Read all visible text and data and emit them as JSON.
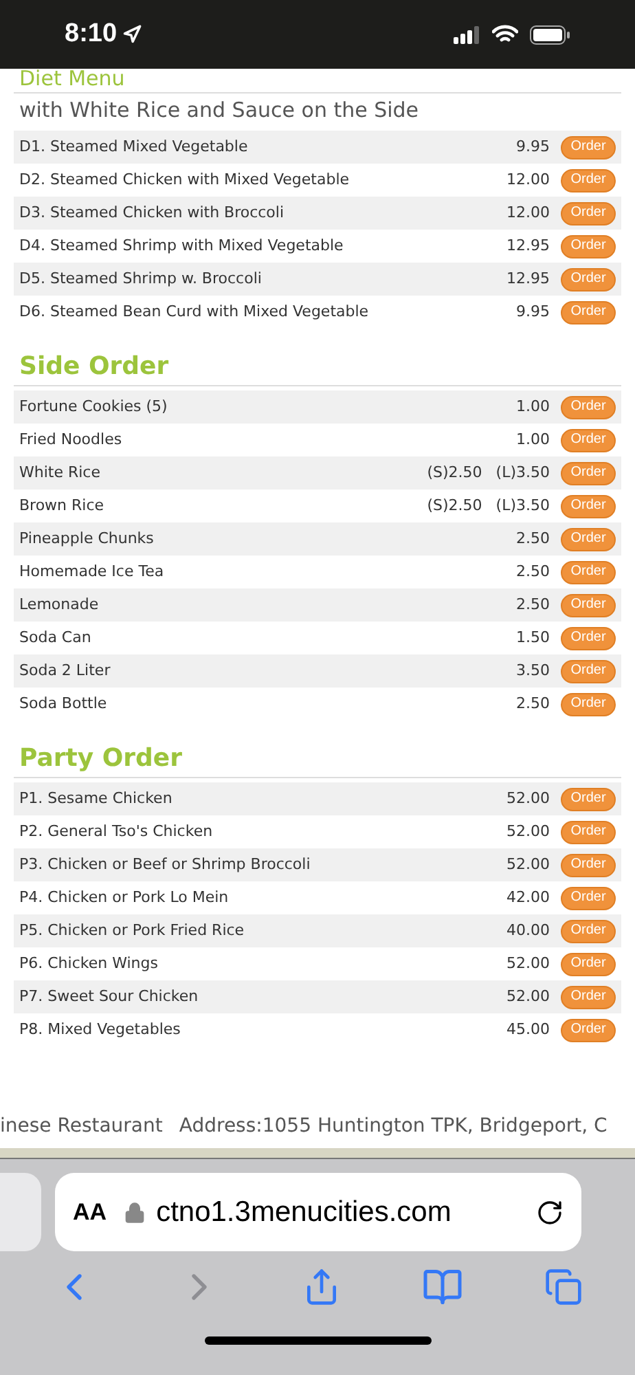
{
  "status_bar": {
    "time": "8:10"
  },
  "sections": [
    {
      "title": "Diet Menu",
      "subtitle": "with White Rice and Sauce on the Side",
      "items": [
        {
          "name": "D1. Steamed Mixed Vegetable",
          "prices": [
            "9.95"
          ],
          "button": "Order"
        },
        {
          "name": "D2. Steamed Chicken with Mixed Vegetable",
          "prices": [
            "12.00"
          ],
          "button": "Order"
        },
        {
          "name": "D3. Steamed Chicken with Broccoli",
          "prices": [
            "12.00"
          ],
          "button": "Order"
        },
        {
          "name": "D4. Steamed Shrimp with Mixed Vegetable",
          "prices": [
            "12.95"
          ],
          "button": "Order"
        },
        {
          "name": "D5. Steamed Shrimp w. Broccoli",
          "prices": [
            "12.95"
          ],
          "button": "Order"
        },
        {
          "name": "D6. Steamed Bean Curd with Mixed Vegetable",
          "prices": [
            "9.95"
          ],
          "button": "Order"
        }
      ]
    },
    {
      "title": "Side Order",
      "items": [
        {
          "name": "Fortune Cookies (5)",
          "prices": [
            "1.00"
          ],
          "button": "Order"
        },
        {
          "name": "Fried Noodles",
          "prices": [
            "1.00"
          ],
          "button": "Order"
        },
        {
          "name": "White Rice",
          "prices": [
            "(S)2.50",
            "(L)3.50"
          ],
          "button": "Order"
        },
        {
          "name": "Brown Rice",
          "prices": [
            "(S)2.50",
            "(L)3.50"
          ],
          "button": "Order"
        },
        {
          "name": "Pineapple Chunks",
          "prices": [
            "2.50"
          ],
          "button": "Order"
        },
        {
          "name": "Homemade Ice Tea",
          "prices": [
            "2.50"
          ],
          "button": "Order"
        },
        {
          "name": "Lemonade",
          "prices": [
            "2.50"
          ],
          "button": "Order"
        },
        {
          "name": "Soda Can",
          "prices": [
            "1.50"
          ],
          "button": "Order"
        },
        {
          "name": "Soda 2 Liter",
          "prices": [
            "3.50"
          ],
          "button": "Order"
        },
        {
          "name": "Soda Bottle",
          "prices": [
            "2.50"
          ],
          "button": "Order"
        }
      ]
    },
    {
      "title": "Party Order",
      "items": [
        {
          "name": "P1. Sesame Chicken",
          "prices": [
            "52.00"
          ],
          "button": "Order"
        },
        {
          "name": "P2. General Tso's Chicken",
          "prices": [
            "52.00"
          ],
          "button": "Order"
        },
        {
          "name": "P3. Chicken or Beef or Shrimp Broccoli",
          "prices": [
            "52.00"
          ],
          "button": "Order"
        },
        {
          "name": "P4. Chicken or Pork Lo Mein",
          "prices": [
            "42.00"
          ],
          "button": "Order"
        },
        {
          "name": "P5. Chicken or Pork Fried Rice",
          "prices": [
            "40.00"
          ],
          "button": "Order"
        },
        {
          "name": "P6. Chicken Wings",
          "prices": [
            "52.00"
          ],
          "button": "Order"
        },
        {
          "name": "P7. Sweet Sour Chicken",
          "prices": [
            "52.00"
          ],
          "button": "Order"
        },
        {
          "name": "P8. Mixed Vegetables",
          "prices": [
            "45.00"
          ],
          "button": "Order"
        }
      ]
    }
  ],
  "footer": {
    "name": "inese Restaurant",
    "address": "Address:1055 Huntington TPK, Bridgeport, C"
  },
  "browser": {
    "text_size_button": "AA",
    "url": "ctno1.3menucities.com"
  }
}
